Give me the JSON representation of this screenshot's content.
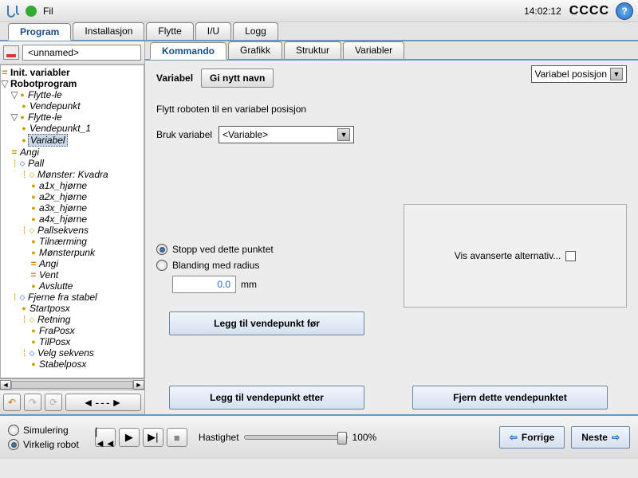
{
  "topbar": {
    "menu_file": "Fil",
    "clock": "14:02:12",
    "cccc": "CCCC"
  },
  "maintabs": [
    "Program",
    "Installasjon",
    "Flytte",
    "I/U",
    "Logg"
  ],
  "maintab_active": 0,
  "filename": "<unnamed>",
  "tree": [
    {
      "ind": 0,
      "ic": "eq",
      "lbl": "Init. variabler",
      "bold": true
    },
    {
      "ind": 0,
      "ic": "tri",
      "lbl": "Robotprogram",
      "bold": true
    },
    {
      "ind": 1,
      "ic": "triY",
      "lbl": "Flytte-le",
      "it": true
    },
    {
      "ind": 2,
      "ic": "by",
      "lbl": "Vendepunkt",
      "it": true
    },
    {
      "ind": 1,
      "ic": "triY",
      "lbl": "Flytte-le",
      "it": true
    },
    {
      "ind": 2,
      "ic": "by",
      "lbl": "Vendepunkt_1",
      "it": true
    },
    {
      "ind": 2,
      "ic": "by",
      "lbl": "Variabel",
      "it": true,
      "sel": true
    },
    {
      "ind": 1,
      "ic": "eq",
      "lbl": "Angi",
      "it": true
    },
    {
      "ind": 1,
      "ic": "dotB",
      "lbl": "Pall",
      "it": true
    },
    {
      "ind": 2,
      "ic": "dotO",
      "lbl": "Mønster: Kvadra",
      "it": true
    },
    {
      "ind": 3,
      "ic": "by",
      "lbl": "a1x_hjørne",
      "it": true
    },
    {
      "ind": 3,
      "ic": "by",
      "lbl": "a2x_hjørne",
      "it": true
    },
    {
      "ind": 3,
      "ic": "by",
      "lbl": "a3x_hjørne",
      "it": true
    },
    {
      "ind": 3,
      "ic": "by",
      "lbl": "a4x_hjørne",
      "it": true
    },
    {
      "ind": 2,
      "ic": "dotO",
      "lbl": "Pallsekvens",
      "it": true
    },
    {
      "ind": 3,
      "ic": "by",
      "lbl": "Tilnærming",
      "it": true
    },
    {
      "ind": 3,
      "ic": "by",
      "lbl": "Mønsterpunk",
      "it": true
    },
    {
      "ind": 3,
      "ic": "eq",
      "lbl": "Angi",
      "it": true
    },
    {
      "ind": 3,
      "ic": "eq",
      "lbl": "Vent",
      "it": true
    },
    {
      "ind": 3,
      "ic": "by",
      "lbl": "Avslutte",
      "it": true
    },
    {
      "ind": 1,
      "ic": "dotB",
      "lbl": "Fjerne fra stabel",
      "it": true
    },
    {
      "ind": 2,
      "ic": "by",
      "lbl": "Startposx",
      "it": true
    },
    {
      "ind": 2,
      "ic": "dotO",
      "lbl": "Retning",
      "it": true
    },
    {
      "ind": 3,
      "ic": "by",
      "lbl": "FraPosx",
      "it": true
    },
    {
      "ind": 3,
      "ic": "by",
      "lbl": "TilPosx",
      "it": true
    },
    {
      "ind": 2,
      "ic": "dotB",
      "lbl": "Velg sekvens",
      "it": true
    },
    {
      "ind": 3,
      "ic": "by",
      "lbl": "Stabelposx",
      "it": true
    }
  ],
  "subtabs": [
    "Kommando",
    "Grafikk",
    "Struktur",
    "Variabler"
  ],
  "subtab_active": 0,
  "panel": {
    "title": "Variabel",
    "rename": "Gi nytt navn",
    "topright": "Variabel posisjon",
    "desc": "Flytt roboten til en variabel posisjon",
    "usevar_label": "Bruk variabel",
    "usevar_value": "<Variable>",
    "radio_stop": "Stopp ved dette punktet",
    "radio_blend": "Blanding med radius",
    "blend_value": "0.0",
    "blend_unit": "mm",
    "adv_label": "Vis avanserte alternativ...",
    "btn_before": "Legg til vendepunkt før",
    "btn_after": "Legg til vendepunkt etter",
    "btn_remove": "Fjern dette vendepunktet"
  },
  "bottom": {
    "sim": "Simulering",
    "real": "Virkelig robot",
    "speed_label": "Hastighet",
    "speed_value": "100%",
    "prev": "Forrige",
    "next": "Neste"
  }
}
